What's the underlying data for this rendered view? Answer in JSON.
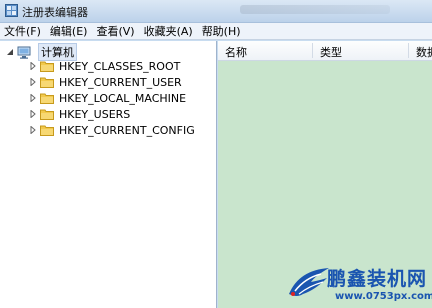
{
  "window": {
    "title": "注册表编辑器"
  },
  "menu": [
    "文件(F)",
    "编辑(E)",
    "查看(V)",
    "收藏夹(A)",
    "帮助(H)"
  ],
  "tree": {
    "root": "计算机",
    "items": [
      "HKEY_CLASSES_ROOT",
      "HKEY_CURRENT_USER",
      "HKEY_LOCAL_MACHINE",
      "HKEY_USERS",
      "HKEY_CURRENT_CONFIG"
    ]
  },
  "list": {
    "columns": [
      "名称",
      "类型",
      "数据"
    ]
  },
  "watermark": {
    "title": "鹏鑫装机网",
    "url": "www.0753px.com"
  },
  "colors": {
    "list_bg": "#c9e5cd",
    "folder": "#f2c94c",
    "watermark": "#1a55b0"
  }
}
